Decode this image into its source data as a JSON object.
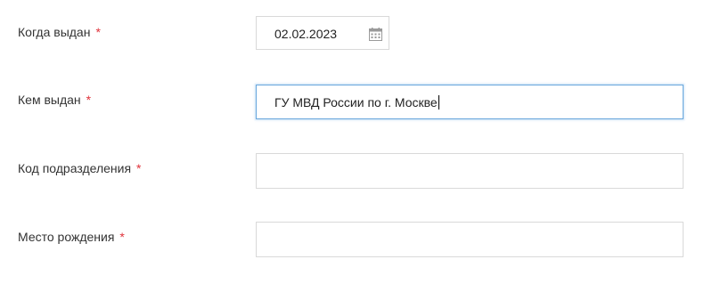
{
  "form": {
    "issue_date": {
      "label": "Когда выдан",
      "required_mark": "*",
      "value": "02.02.2023",
      "icon": "calendar-icon"
    },
    "issued_by": {
      "label": "Кем выдан",
      "required_mark": "*",
      "value": "ГУ МВД России по г. Москве",
      "focused": true
    },
    "division_code": {
      "label": "Код подразделения",
      "required_mark": "*",
      "value": ""
    },
    "birth_place": {
      "label": "Место рождения",
      "required_mark": "*",
      "value": ""
    }
  },
  "colors": {
    "required": "#e0323a",
    "focus_border": "#6aa8dd",
    "field_border": "#d9d9d9",
    "label_text": "#333333"
  }
}
